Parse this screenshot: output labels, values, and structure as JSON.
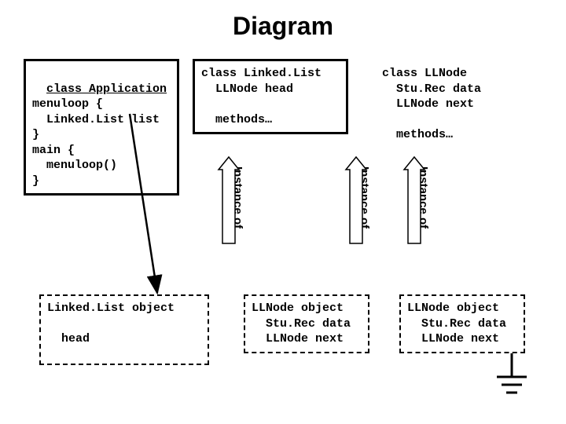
{
  "title": "Diagram",
  "boxes": {
    "application": {
      "header": "class Application",
      "body": "menuloop {\n  Linked.List list\n}\nmain {\n  menuloop()\n}"
    },
    "linkedlist": "class Linked.List\n  LLNode head\n\n  methods…",
    "llnode": "class LLNode\n  Stu.Rec data\n  LLNode next\n\n  methods…"
  },
  "objects": {
    "linkedlist_obj": "Linked.List object\n\n  head",
    "llnode_obj1": "LLNode object\n  Stu.Rec data\n  LLNode next",
    "llnode_obj2": "LLNode object\n  Stu.Rec data\n  LLNode next"
  },
  "arrow_label": "Instance of"
}
